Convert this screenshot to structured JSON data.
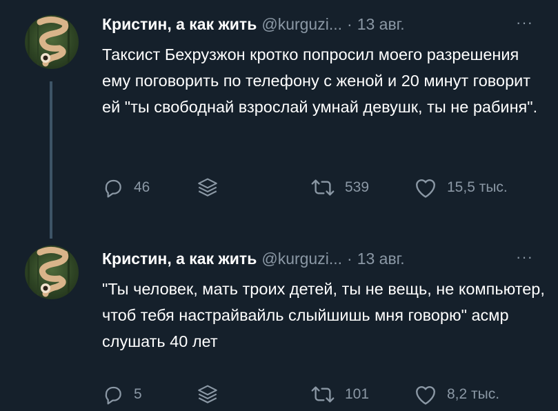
{
  "tweets": [
    {
      "author_name": "Кристин, а как жить",
      "handle": "@kurguzi...",
      "separator": "·",
      "date": "13 авг.",
      "more": "···",
      "text": "Таксист Бехрузжон кротко попросил моего разрешения ему поговорить по телефону с женой и 20 минут говорит ей \"ты свободнай взрослай умнай девушк, ты не рабиня\".",
      "replies": "46",
      "retweets": "539",
      "likes": "15,5 тыс."
    },
    {
      "author_name": "Кристин, а как жить",
      "handle": "@kurguzi...",
      "separator": "·",
      "date": "13 авг.",
      "more": "···",
      "text": "\"Ты человек, мать троих детей, ты не вещь, не компьютер, чтоб тебя настрайвайль слыйшишь мня говорю\" асмр слушать 40 лет",
      "replies": "5",
      "retweets": "101",
      "likes": "8,2 тыс."
    }
  ],
  "icons": {
    "reply": "reply-icon",
    "share": "share-icon",
    "retweet": "retweet-icon",
    "like": "heart-icon",
    "more": "more-icon"
  },
  "colors": {
    "background": "#15202b",
    "text": "#ffffff",
    "secondary": "#8b98a5",
    "thread_line": "#3d5466"
  }
}
